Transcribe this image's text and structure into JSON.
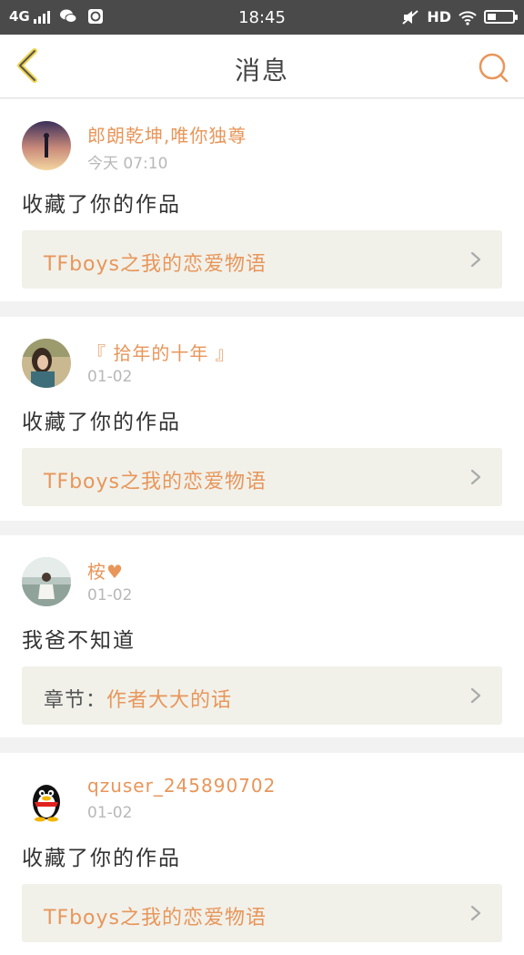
{
  "status_bar": {
    "network": "4G",
    "time": "18:45",
    "hd": "HD",
    "battery_level": 0.35
  },
  "header": {
    "title": "消息",
    "back_icon": "chevron-left-icon",
    "search_icon": "search-icon"
  },
  "messages": [
    {
      "username": "郎朗乾坤,唯你独尊",
      "time": "今天 07:10",
      "action": "收藏了你的作品",
      "ref_prefix": "",
      "ref_title": "TFboys之我的恋爱物语"
    },
    {
      "username": "『 拾年的十年 』",
      "time": "01-02",
      "action": "收藏了你的作品",
      "ref_prefix": "",
      "ref_title": "TFboys之我的恋爱物语"
    },
    {
      "username": "桉♥",
      "time": "01-02",
      "action": "我爸不知道",
      "ref_prefix": "章节：",
      "ref_title": "作者大大的话"
    },
    {
      "username": "qzuser_245890702",
      "time": "01-02",
      "action": "收藏了你的作品",
      "ref_prefix": "",
      "ref_title": "TFboys之我的恋爱物语"
    }
  ],
  "colors": {
    "accent": "#e8965a",
    "status_bar": "#4a4a4a",
    "ref_bg": "#f1f1ea"
  }
}
